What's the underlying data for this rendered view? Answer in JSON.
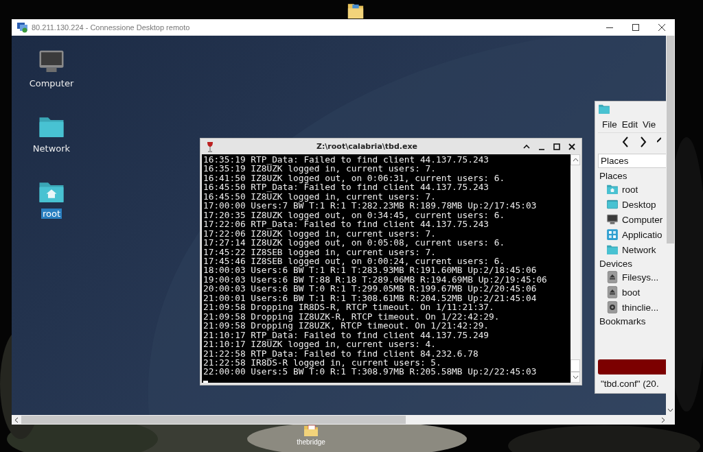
{
  "host_window": {
    "title": "80.211.130.224 - Connessione Desktop remoto"
  },
  "remote_desktop": {
    "icons": [
      {
        "label": "Computer",
        "kind": "computer",
        "selected": false
      },
      {
        "label": "Network",
        "kind": "folder",
        "selected": false
      },
      {
        "label": "root",
        "kind": "home",
        "selected": true
      }
    ]
  },
  "terminal": {
    "title": "Z:\\root\\calabria\\tbd.exe",
    "lines": [
      "16:35:19 RTP_Data: Failed to find client 44.137.75.243",
      "16:35:19 IZ8UZK logged in, current users: 7.",
      "16:41:50 IZ8UZK logged out, on 0:06:31, current users: 6.",
      "16:45:50 RTP_Data: Failed to find client 44.137.75.243",
      "16:45:50 IZ8UZK logged in, current users: 7.",
      "17:00:00 Users:7 BW T:1 R:1 T:282.23MB R:189.78MB Up:2/17:45:03",
      "17:20:35 IZ8UZK logged out, on 0:34:45, current users: 6.",
      "17:22:06 RTP_Data: Failed to find client 44.137.75.243",
      "17:22:06 IZ8UZK logged in, current users: 7.",
      "17:27:14 IZ8UZK logged out, on 0:05:08, current users: 6.",
      "17:45:22 IZ8SEB logged in, current users: 7.",
      "17:45:46 IZ8SEB logged out, on 0:00:24, current users: 6.",
      "18:00:03 Users:6 BW T:1 R:1 T:283.93MB R:191.60MB Up:2/18:45:06",
      "19:00:03 Users:6 BW T:88 R:18 T:289.06MB R:194.69MB Up:2/19:45:06",
      "20:00:03 Users:6 BW T:0 R:1 T:299.05MB R:199.67MB Up:2/20:45:06",
      "21:00:01 Users:6 BW T:1 R:1 T:308.61MB R:204.52MB Up:2/21:45:04",
      "21:09:58 Dropping IR8DS-R, RTCP timeout. On 1/11:21:37.",
      "21:09:58 Dropping IZ8UZK-R, RTCP timeout. On 1/22:42:29.",
      "21:09:58 Dropping IZ8UZK, RTCP timeout. On 1/21:42:29.",
      "21:10:17 RTP_Data: Failed to find client 44.137.75.249",
      "21:10:17 IZ8UZK logged in, current users: 4.",
      "21:22:58 RTP_Data: Failed to find client 84.232.6.78",
      "21:22:58 IR8DS-R logged in, current users: 5.",
      "22:00:00 Users:5 BW T:0 R:1 T:308.97MB R:205.58MB Up:2/22:45:03"
    ]
  },
  "file_manager": {
    "menu": [
      "File",
      "Edit",
      "Vie"
    ],
    "location": "Places",
    "sections": [
      {
        "title": "Places",
        "items": [
          {
            "label": "root",
            "kind": "home"
          },
          {
            "label": "Desktop",
            "kind": "desktop"
          },
          {
            "label": "Computer",
            "kind": "computer"
          },
          {
            "label": "Applicatio",
            "kind": "apps"
          },
          {
            "label": "Network",
            "kind": "folder"
          }
        ]
      },
      {
        "title": "Devices",
        "items": [
          {
            "label": "Filesys...",
            "kind": "eject"
          },
          {
            "label": "boot",
            "kind": "eject"
          },
          {
            "label": "thinclie...",
            "kind": "disk"
          }
        ]
      },
      {
        "title": "Bookmarks"
      }
    ],
    "status": "\"tbd.conf\" (20."
  },
  "host_desktop": {
    "icons": [
      {
        "label": "thebridge"
      }
    ]
  }
}
